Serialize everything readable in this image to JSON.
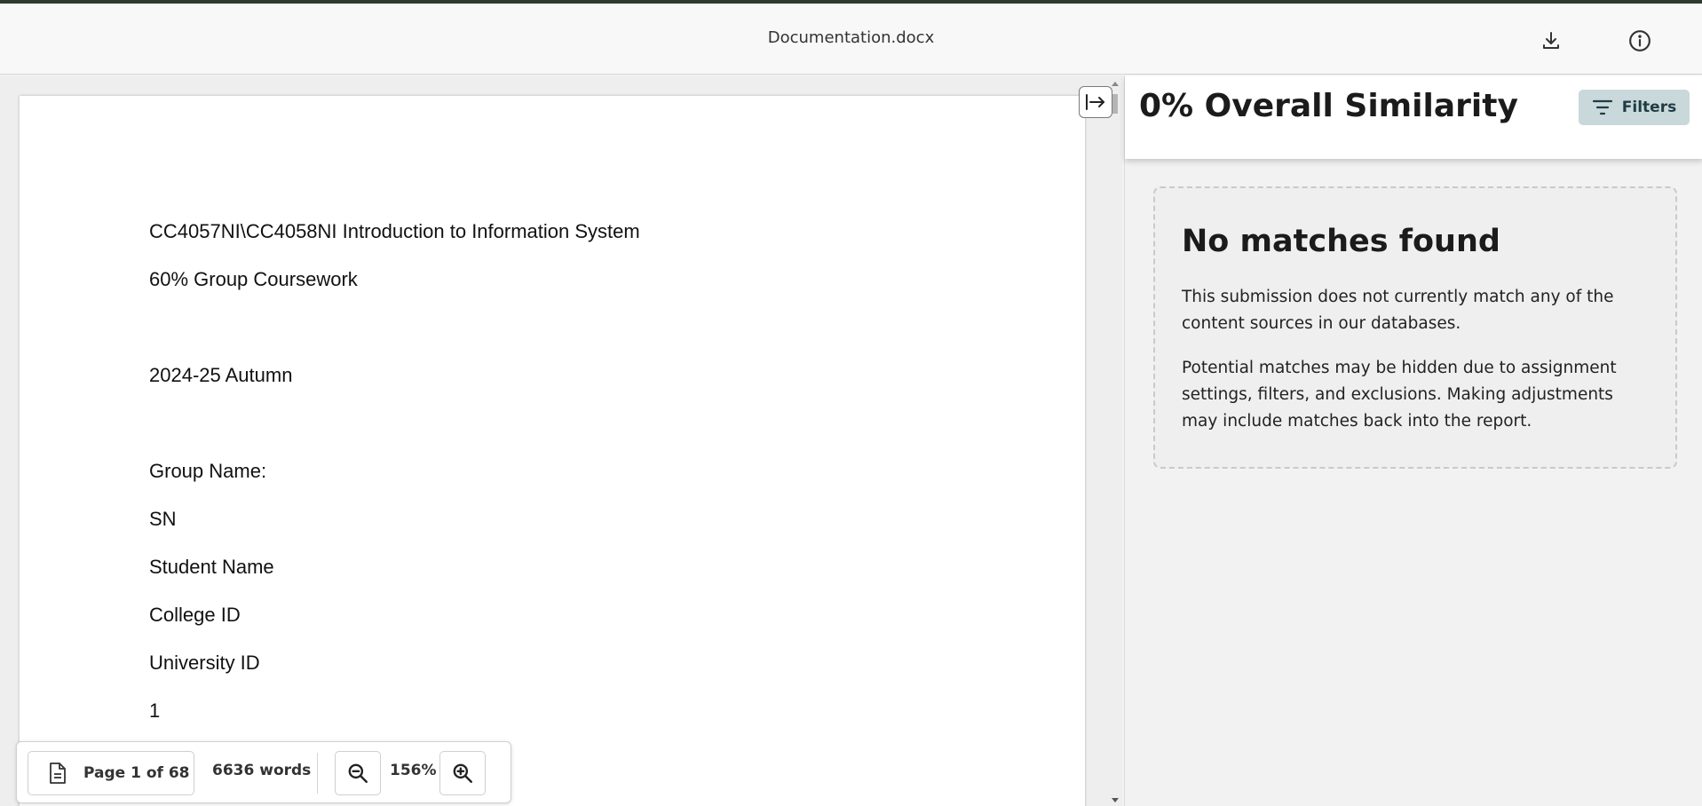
{
  "header": {
    "file_name": "Documentation.docx",
    "download_icon": "download-icon",
    "info_icon": "info-icon"
  },
  "document": {
    "lines": [
      "CC4057NI\\CC4058NI Introduction to Information System",
      "60% Group Coursework",
      "2024-25 Autumn",
      "Group Name:",
      "SN",
      "Student Name",
      "College ID",
      "University ID",
      "1"
    ]
  },
  "toolbar": {
    "page_icon": "document-icon",
    "page_label": "Page 1 of 68",
    "word_count": "6636 words",
    "zoom_out_icon": "zoom-out-icon",
    "zoom_level": "156%",
    "zoom_in_icon": "zoom-in-icon"
  },
  "sidebar": {
    "collapse_icon": "collapse-panel-icon",
    "title": "0% Overall Similarity",
    "filters_label": "Filters",
    "filters_icon": "filter-icon",
    "no_matches": {
      "title": "No matches found",
      "paragraph1": "This submission does not currently match any of the content sources in our databases.",
      "paragraph2": "Potential matches may be hidden due to assignment settings, filters, and exclusions. Making adjustments may include matches back into the report."
    }
  },
  "colors": {
    "filters_button_bg": "#c9d8da",
    "top_accent": "#2d3a2f"
  }
}
